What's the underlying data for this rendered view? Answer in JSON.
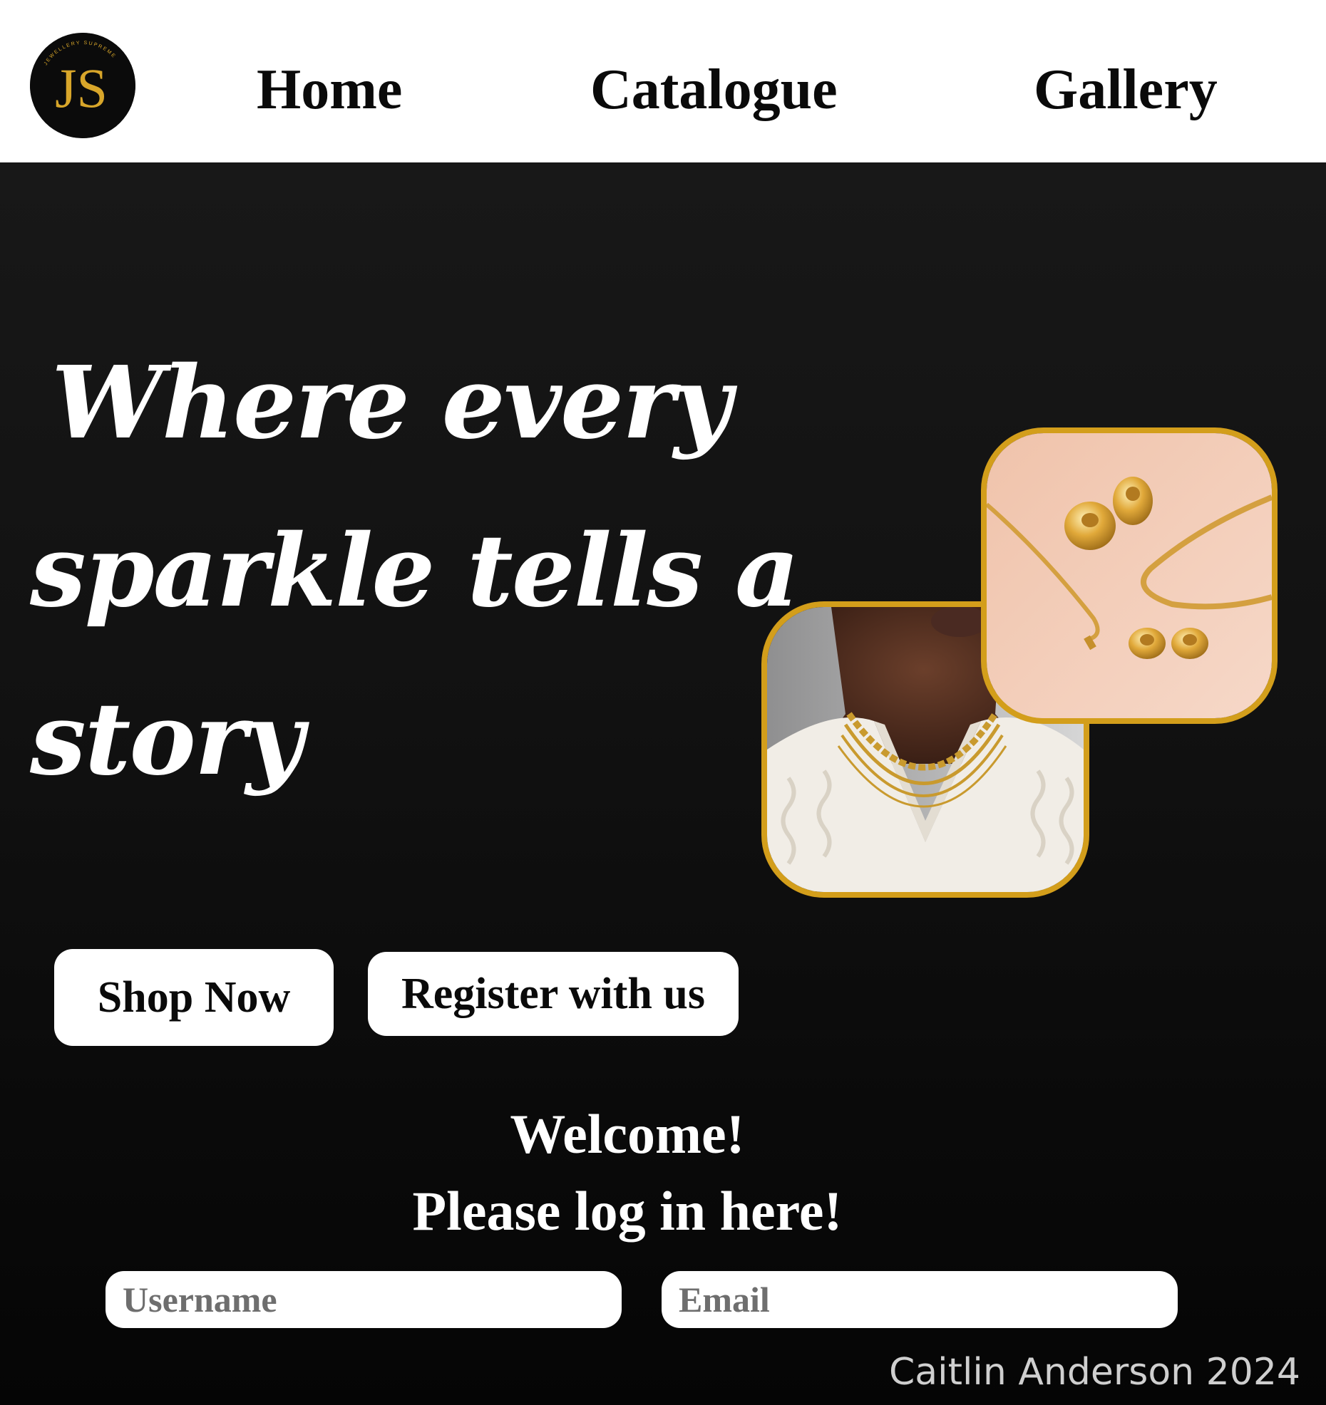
{
  "colors": {
    "header_bg": "#ffffff",
    "hero_bg": "#121212",
    "accent_gold": "#d39e1b",
    "text_light": "#ffffff"
  },
  "logo": {
    "monogram": "JS",
    "ring_text": "JEWELLERY SUPREME"
  },
  "nav": {
    "items": [
      {
        "label": "Home"
      },
      {
        "label": "Catalogue"
      },
      {
        "label": "Gallery"
      }
    ]
  },
  "hero": {
    "tagline_lines": [
      "Where every",
      "sparkle tells a",
      "story"
    ],
    "images": [
      {
        "name": "woman wearing gold chain necklaces"
      },
      {
        "name": "gold hoop earrings and snake chain necklaces"
      }
    ],
    "buttons": {
      "shop": "Shop Now",
      "register": "Register with us"
    }
  },
  "login": {
    "heading_line1": "Welcome!",
    "heading_line2": "Please log in here!",
    "username_placeholder": "Username",
    "email_placeholder": "Email"
  },
  "footer": {
    "credit": "Caitlin Anderson 2024"
  }
}
